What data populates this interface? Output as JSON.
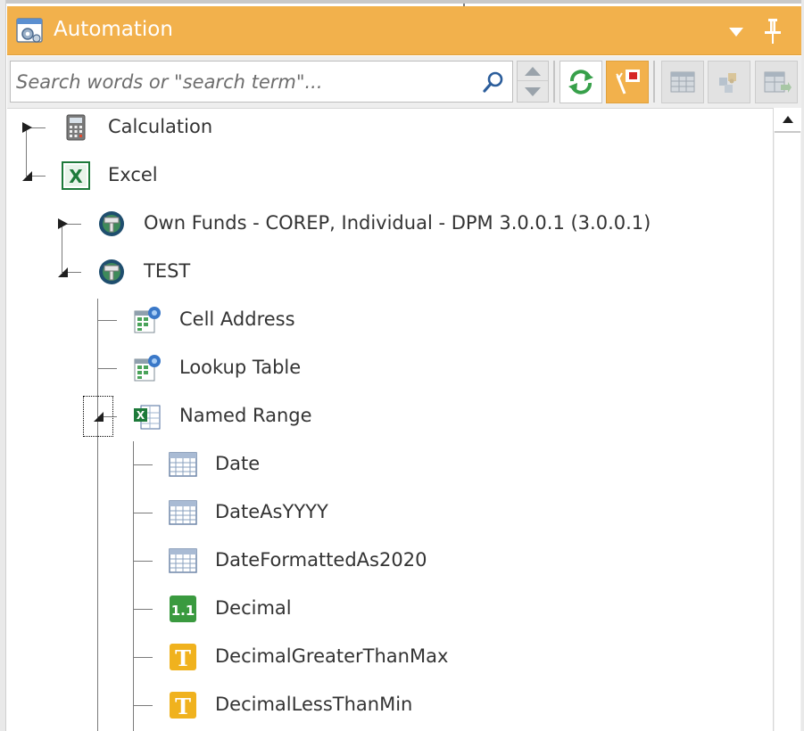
{
  "panel": {
    "title": "Automation",
    "colors": {
      "accent": "#f2b14c",
      "text": "#333333",
      "tree_line": "#7a7a7a"
    }
  },
  "toolbar": {
    "search_placeholder": "Search words or \"search term\"...",
    "search_value": "",
    "buttons": [
      {
        "name": "refresh-button",
        "icon": "refresh-icon",
        "state": "normal"
      },
      {
        "name": "highlight-button",
        "icon": "wand-flag-icon",
        "state": "active"
      },
      {
        "name": "table-view-button",
        "icon": "table-icon",
        "state": "disabled"
      },
      {
        "name": "puzzle-button",
        "icon": "puzzle-icon",
        "state": "disabled"
      },
      {
        "name": "export-table-button",
        "icon": "table-export-icon",
        "state": "disabled"
      }
    ]
  },
  "tree": {
    "nodes": [
      {
        "label": "Calculation",
        "icon": "calculator-icon",
        "expanded": false
      },
      {
        "label": "Excel",
        "icon": "excel-icon",
        "expanded": true
      },
      {
        "label": "Own Funds - COREP, Individual - DPM 3.0.0.1 (3.0.0.1)",
        "icon": "taxonomy-globe-icon",
        "expanded": false
      },
      {
        "label": "TEST",
        "icon": "taxonomy-globe-icon",
        "expanded": true
      },
      {
        "label": "Cell Address",
        "icon": "cell-address-icon"
      },
      {
        "label": "Lookup Table",
        "icon": "lookup-table-icon"
      },
      {
        "label": "Named Range",
        "icon": "named-range-icon",
        "expanded": true
      },
      {
        "label": "Date",
        "icon": "date-grid-icon"
      },
      {
        "label": "DateAsYYYY",
        "icon": "date-grid-icon"
      },
      {
        "label": "DateFormattedAs2020",
        "icon": "date-grid-icon"
      },
      {
        "label": "Decimal",
        "icon": "decimal-icon",
        "icon_text": "1.1"
      },
      {
        "label": "DecimalGreaterThanMax",
        "icon": "text-t-icon",
        "icon_text": "T"
      },
      {
        "label": "DecimalLessThanMin",
        "icon": "text-t-icon",
        "icon_text": "T"
      }
    ]
  }
}
